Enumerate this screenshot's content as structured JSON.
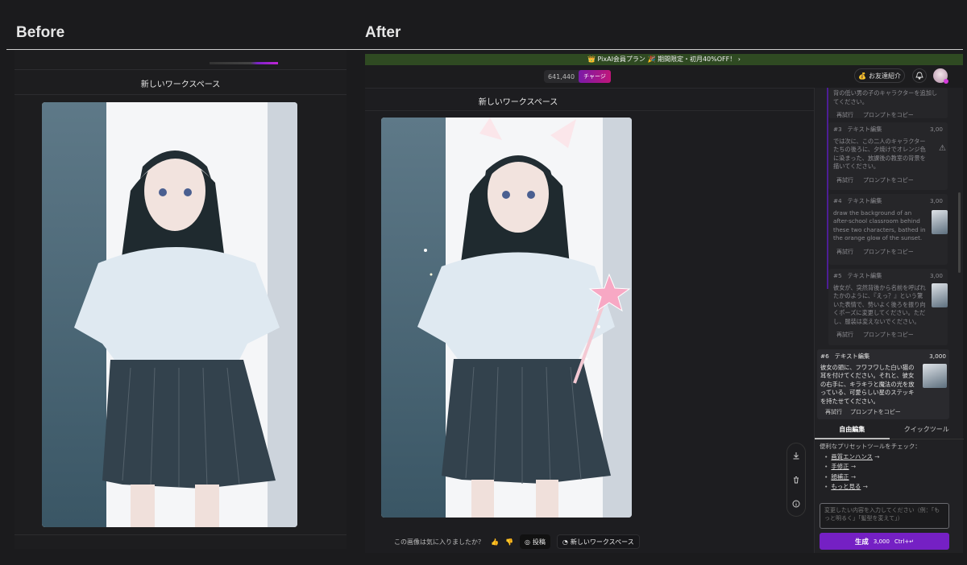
{
  "labels": {
    "before": "Before",
    "after": "After"
  },
  "before_panel": {
    "workspace_title": "新しいワークスペース"
  },
  "app": {
    "promo": "👑 PixAI会員プラン 🎉 期間限定・初月40%OFF！ ›",
    "credits": {
      "amount": "641,440",
      "charge_label": "チャージ"
    },
    "invite_label": "お友達紹介",
    "workspace_title": "新しいワークスペース",
    "feedback": {
      "question": "この画像は気に入りましたか？",
      "post_label": "投稿",
      "new_workspace_label": "新しいワークスペース"
    },
    "history": [
      {
        "body": "背の低い男の子のキャラクターを追加してください。",
        "retry": "再試行",
        "copy": "プロンプトをコピー"
      },
      {
        "num": "#3",
        "title": "テキスト編集",
        "cost": "3,00",
        "body": "では次に、この二人のキャラクターたちの後ろに、夕焼けでオレンジ色に染まった、放課後の教室の背景を描いてください。",
        "retry": "再試行",
        "copy": "プロンプトをコピー"
      },
      {
        "num": "#4",
        "title": "テキスト編集",
        "cost": "3,00",
        "body": "draw the background of an after-school classroom behind these two characters, bathed in the orange glow of the sunset.",
        "retry": "再試行",
        "copy": "プロンプトをコピー"
      },
      {
        "num": "#5",
        "title": "テキスト編集",
        "cost": "3,00",
        "body": "彼女が、突然背後から名前を呼ばれたかのように、『えっ？』という驚いた表情で、勢いよく後ろを振り向くポーズに変更してください。ただし、服装は変えないでください。",
        "retry": "再試行",
        "copy": "プロンプトをコピー"
      }
    ],
    "active": {
      "num": "#6",
      "title": "テキスト編集",
      "cost": "3,000",
      "body": "彼女の頭に、フワフワした白い猫の耳を付けてください。それと、彼女の右手に、キラキラと魔法の光を放っている、可愛らしい星のステッキを持たせてください。",
      "retry": "再試行",
      "copy": "プロンプトをコピー"
    },
    "tabs": {
      "free_edit": "自由編集",
      "quick_tools": "クイックツール"
    },
    "presets": {
      "heading": "便利なプリセットツールをチェック：",
      "items": [
        "画質エンハンス",
        "手修正",
        "顔補正",
        "もっと見る"
      ]
    },
    "prompt_placeholder": "変更したい内容を入力してください（例：「もっと明るく」「髪型を変えて」）",
    "generate": {
      "label": "生成",
      "cost": "3,000",
      "shortcut": "Ctrl+↵"
    }
  },
  "colors": {
    "accent": "#7520c4",
    "promo_bg": "#2f4a22",
    "charge": "#c0157a"
  }
}
